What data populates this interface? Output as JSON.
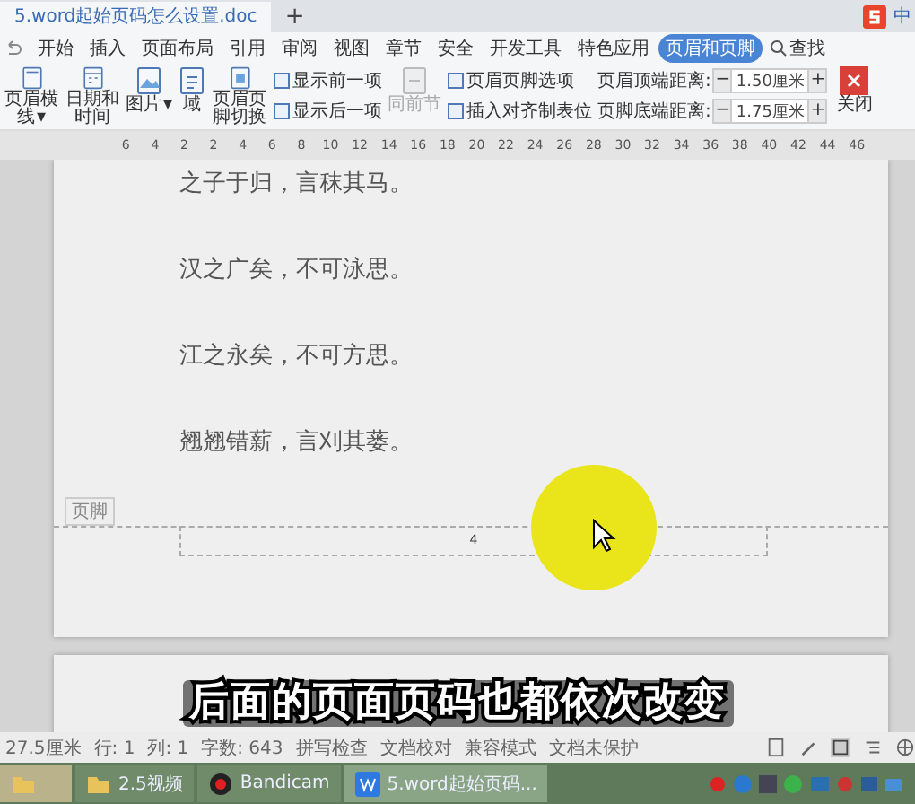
{
  "title_bar": {
    "tabs": [
      {
        "label": "5.word起始页码怎么设置.doc",
        "selected": true
      }
    ],
    "new_tab": "+",
    "ime": "中"
  },
  "menu": [
    {
      "label": "开始",
      "selected": false
    },
    {
      "label": "插入",
      "selected": false
    },
    {
      "label": "页面布局",
      "selected": false
    },
    {
      "label": "引用",
      "selected": false
    },
    {
      "label": "审阅",
      "selected": false
    },
    {
      "label": "视图",
      "selected": false
    },
    {
      "label": "章节",
      "selected": false
    },
    {
      "label": "安全",
      "selected": false
    },
    {
      "label": "开发工具",
      "selected": false
    },
    {
      "label": "特色应用",
      "selected": false
    },
    {
      "label": "页眉和页脚",
      "selected": true
    }
  ],
  "search": "查找",
  "ribbon": [
    {
      "kind": "large",
      "label": "页眉横线",
      "dropdown": "▾"
    },
    {
      "kind": "large",
      "label": "日期和时间"
    },
    {
      "kind": "large",
      "label": "图片",
      "dropdown": "▾"
    },
    {
      "kind": "large",
      "label": "域"
    },
    {
      "kind": "large",
      "label": "页眉页脚切换"
    },
    {
      "kind": "stack",
      "items": [
        {
          "label": "显示前一项",
          "disabled": false
        },
        {
          "label": "显示后一项",
          "disabled": false
        }
      ]
    },
    {
      "kind": "large",
      "label": "同前节",
      "disabled": true
    },
    {
      "kind": "stack",
      "items": [
        {
          "label": "页眉页脚选项",
          "disabled": false
        },
        {
          "label": "插入对齐制表位",
          "disabled": false
        }
      ]
    },
    {
      "kind": "spinners",
      "rows": [
        {
          "label": "页眉顶端距离:",
          "value": "1.50厘米",
          "minus": "−",
          "plus": "+"
        },
        {
          "label": "页脚底端距离:",
          "value": "1.75厘米",
          "minus": "−",
          "plus": "+"
        }
      ]
    },
    {
      "kind": "close",
      "label": "关闭"
    }
  ],
  "ruler": [
    "6",
    "4",
    "2",
    "2",
    "4",
    "6",
    "8",
    "10",
    "12",
    "14",
    "16",
    "18",
    "20",
    "22",
    "24",
    "26",
    "28",
    "30",
    "32",
    "34",
    "36",
    "38",
    "40",
    "42",
    "44",
    "46"
  ],
  "document": {
    "lines": [
      "之子于归，言秣其马。",
      "汉之广矣，不可泳思。",
      "江之永矣，不可方思。",
      "翘翘错薪，言刈其蒌。"
    ],
    "footer_label": "页脚",
    "page_number": "4"
  },
  "subtitle": "后面的页面页码也都依次改变",
  "status_bar": [
    "27.5厘米",
    "行: 1",
    "列: 1",
    "字数: 643",
    "拼写检查",
    "文档校对",
    "兼容模式",
    "文档未保护"
  ],
  "taskbar": [
    {
      "label": "2.5视频",
      "selected": false
    },
    {
      "label": "Bandicam",
      "selected": false
    },
    {
      "label": "5.word起始页码...",
      "selected": true
    }
  ]
}
